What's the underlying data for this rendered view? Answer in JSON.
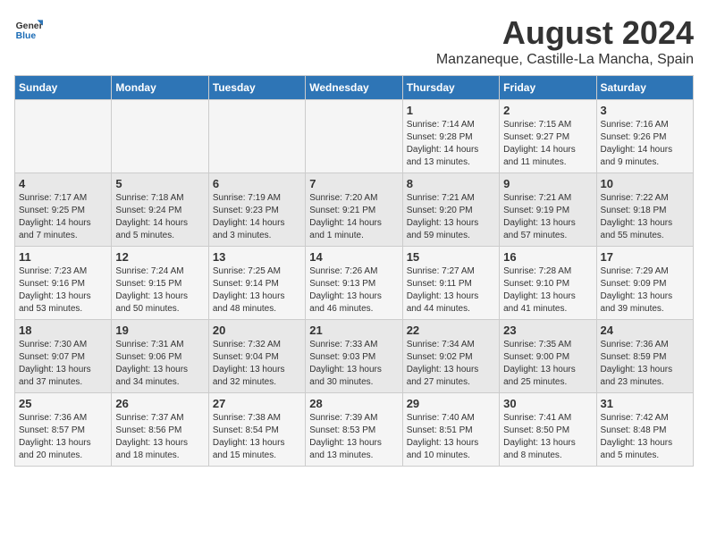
{
  "header": {
    "logo_general": "General",
    "logo_blue": "Blue",
    "title": "August 2024",
    "subtitle": "Manzaneque, Castille-La Mancha, Spain"
  },
  "calendar": {
    "days_of_week": [
      "Sunday",
      "Monday",
      "Tuesday",
      "Wednesday",
      "Thursday",
      "Friday",
      "Saturday"
    ],
    "weeks": [
      [
        {
          "day": "",
          "info": ""
        },
        {
          "day": "",
          "info": ""
        },
        {
          "day": "",
          "info": ""
        },
        {
          "day": "",
          "info": ""
        },
        {
          "day": "1",
          "info": "Sunrise: 7:14 AM\nSunset: 9:28 PM\nDaylight: 14 hours\nand 13 minutes."
        },
        {
          "day": "2",
          "info": "Sunrise: 7:15 AM\nSunset: 9:27 PM\nDaylight: 14 hours\nand 11 minutes."
        },
        {
          "day": "3",
          "info": "Sunrise: 7:16 AM\nSunset: 9:26 PM\nDaylight: 14 hours\nand 9 minutes."
        }
      ],
      [
        {
          "day": "4",
          "info": "Sunrise: 7:17 AM\nSunset: 9:25 PM\nDaylight: 14 hours\nand 7 minutes."
        },
        {
          "day": "5",
          "info": "Sunrise: 7:18 AM\nSunset: 9:24 PM\nDaylight: 14 hours\nand 5 minutes."
        },
        {
          "day": "6",
          "info": "Sunrise: 7:19 AM\nSunset: 9:23 PM\nDaylight: 14 hours\nand 3 minutes."
        },
        {
          "day": "7",
          "info": "Sunrise: 7:20 AM\nSunset: 9:21 PM\nDaylight: 14 hours\nand 1 minute."
        },
        {
          "day": "8",
          "info": "Sunrise: 7:21 AM\nSunset: 9:20 PM\nDaylight: 13 hours\nand 59 minutes."
        },
        {
          "day": "9",
          "info": "Sunrise: 7:21 AM\nSunset: 9:19 PM\nDaylight: 13 hours\nand 57 minutes."
        },
        {
          "day": "10",
          "info": "Sunrise: 7:22 AM\nSunset: 9:18 PM\nDaylight: 13 hours\nand 55 minutes."
        }
      ],
      [
        {
          "day": "11",
          "info": "Sunrise: 7:23 AM\nSunset: 9:16 PM\nDaylight: 13 hours\nand 53 minutes."
        },
        {
          "day": "12",
          "info": "Sunrise: 7:24 AM\nSunset: 9:15 PM\nDaylight: 13 hours\nand 50 minutes."
        },
        {
          "day": "13",
          "info": "Sunrise: 7:25 AM\nSunset: 9:14 PM\nDaylight: 13 hours\nand 48 minutes."
        },
        {
          "day": "14",
          "info": "Sunrise: 7:26 AM\nSunset: 9:13 PM\nDaylight: 13 hours\nand 46 minutes."
        },
        {
          "day": "15",
          "info": "Sunrise: 7:27 AM\nSunset: 9:11 PM\nDaylight: 13 hours\nand 44 minutes."
        },
        {
          "day": "16",
          "info": "Sunrise: 7:28 AM\nSunset: 9:10 PM\nDaylight: 13 hours\nand 41 minutes."
        },
        {
          "day": "17",
          "info": "Sunrise: 7:29 AM\nSunset: 9:09 PM\nDaylight: 13 hours\nand 39 minutes."
        }
      ],
      [
        {
          "day": "18",
          "info": "Sunrise: 7:30 AM\nSunset: 9:07 PM\nDaylight: 13 hours\nand 37 minutes."
        },
        {
          "day": "19",
          "info": "Sunrise: 7:31 AM\nSunset: 9:06 PM\nDaylight: 13 hours\nand 34 minutes."
        },
        {
          "day": "20",
          "info": "Sunrise: 7:32 AM\nSunset: 9:04 PM\nDaylight: 13 hours\nand 32 minutes."
        },
        {
          "day": "21",
          "info": "Sunrise: 7:33 AM\nSunset: 9:03 PM\nDaylight: 13 hours\nand 30 minutes."
        },
        {
          "day": "22",
          "info": "Sunrise: 7:34 AM\nSunset: 9:02 PM\nDaylight: 13 hours\nand 27 minutes."
        },
        {
          "day": "23",
          "info": "Sunrise: 7:35 AM\nSunset: 9:00 PM\nDaylight: 13 hours\nand 25 minutes."
        },
        {
          "day": "24",
          "info": "Sunrise: 7:36 AM\nSunset: 8:59 PM\nDaylight: 13 hours\nand 23 minutes."
        }
      ],
      [
        {
          "day": "25",
          "info": "Sunrise: 7:36 AM\nSunset: 8:57 PM\nDaylight: 13 hours\nand 20 minutes."
        },
        {
          "day": "26",
          "info": "Sunrise: 7:37 AM\nSunset: 8:56 PM\nDaylight: 13 hours\nand 18 minutes."
        },
        {
          "day": "27",
          "info": "Sunrise: 7:38 AM\nSunset: 8:54 PM\nDaylight: 13 hours\nand 15 minutes."
        },
        {
          "day": "28",
          "info": "Sunrise: 7:39 AM\nSunset: 8:53 PM\nDaylight: 13 hours\nand 13 minutes."
        },
        {
          "day": "29",
          "info": "Sunrise: 7:40 AM\nSunset: 8:51 PM\nDaylight: 13 hours\nand 10 minutes."
        },
        {
          "day": "30",
          "info": "Sunrise: 7:41 AM\nSunset: 8:50 PM\nDaylight: 13 hours\nand 8 minutes."
        },
        {
          "day": "31",
          "info": "Sunrise: 7:42 AM\nSunset: 8:48 PM\nDaylight: 13 hours\nand 5 minutes."
        }
      ]
    ]
  }
}
